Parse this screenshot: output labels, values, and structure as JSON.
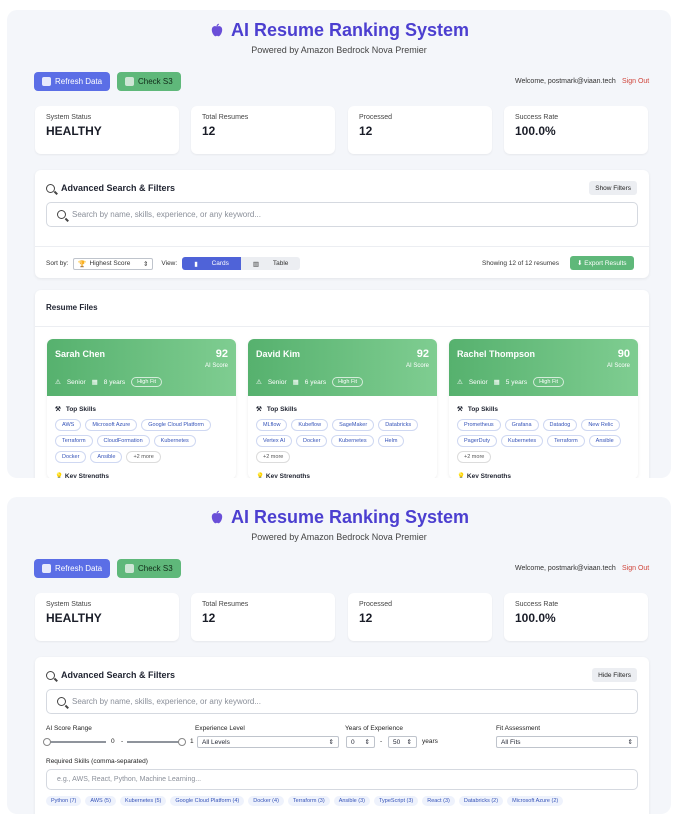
{
  "header": {
    "title": "AI Resume Ranking System",
    "subtitle": "Powered by Amazon Bedrock Nova Premier"
  },
  "toolbar": {
    "refresh_label": "Refresh Data",
    "check_s3_label": "Check S3",
    "welcome": "Welcome, postmark@viaan.tech",
    "signout": "Sign Out"
  },
  "stats": [
    {
      "label": "System Status",
      "value": "HEALTHY"
    },
    {
      "label": "Total Resumes",
      "value": "12"
    },
    {
      "label": "Processed",
      "value": "12"
    },
    {
      "label": "Success Rate",
      "value": "100.0%"
    }
  ],
  "search": {
    "title": "Advanced Search & Filters",
    "show_filters": "Show Filters",
    "hide_filters": "Hide Filters",
    "placeholder": "Search by name, skills, experience, or any keyword..."
  },
  "sortbar": {
    "sort_label": "Sort by:",
    "sort_value": "Highest Score",
    "view_label": "View:",
    "view_cards": "Cards",
    "view_table": "Table",
    "showing": "Showing 12 of 12 resumes",
    "export": "Export Results"
  },
  "resume_files": {
    "title": "Resume Files",
    "score_label": "AI Score",
    "top_skills_label": "Top Skills",
    "key_strengths_label": "Key Strengths",
    "cards": [
      {
        "name": "Sarah Chen",
        "score": "92",
        "level": "Senior",
        "years": "8 years",
        "fit": "High Fit",
        "skills": [
          "AWS",
          "Microsoft Azure",
          "Google Cloud Platform",
          "Terraform",
          "CloudFormation",
          "Kubernetes",
          "Docker",
          "Ansible"
        ],
        "more": "+2 more"
      },
      {
        "name": "David Kim",
        "score": "92",
        "level": "Senior",
        "years": "6 years",
        "fit": "High Fit",
        "skills": [
          "MLflow",
          "Kubeflow",
          "SageMaker",
          "Databricks",
          "Vertex AI",
          "Docker",
          "Kubernetes",
          "Helm"
        ],
        "more": "+2 more"
      },
      {
        "name": "Rachel Thompson",
        "score": "90",
        "level": "Senior",
        "years": "5 years",
        "fit": "High Fit",
        "skills": [
          "Prometheus",
          "Grafana",
          "Datadog",
          "New Relic",
          "PagerDuty",
          "Kubernetes",
          "Terraform",
          "Ansible"
        ],
        "more": "+2 more"
      }
    ]
  },
  "filters": {
    "score_range_label": "AI Score Range",
    "score_min": "0",
    "score_dash": "-",
    "score_max": "1",
    "experience_level_label": "Experience Level",
    "experience_level_value": "All Levels",
    "years_label": "Years of Experience",
    "years_min": "0",
    "years_dash": "-",
    "years_max": "50",
    "years_unit": "years",
    "fit_label": "Fit Assessment",
    "fit_value": "All Fits",
    "skills_label": "Required Skills (comma-separated)",
    "skills_placeholder": "e.g., AWS, React, Python, Machine Learning...",
    "skill_pills": [
      "Python (7)",
      "AWS (5)",
      "Kubernetes (5)",
      "Google Cloud Platform (4)",
      "Docker (4)",
      "Terraform (3)",
      "Ansible (3)",
      "TypeScript (3)",
      "React (3)",
      "Databricks (2)",
      "Microsoft Azure (2)"
    ]
  },
  "colors": {
    "accent": "#4c3fd0",
    "primary_button": "#5b6ee6",
    "success": "#5fb87a",
    "danger": "#d0463c"
  }
}
